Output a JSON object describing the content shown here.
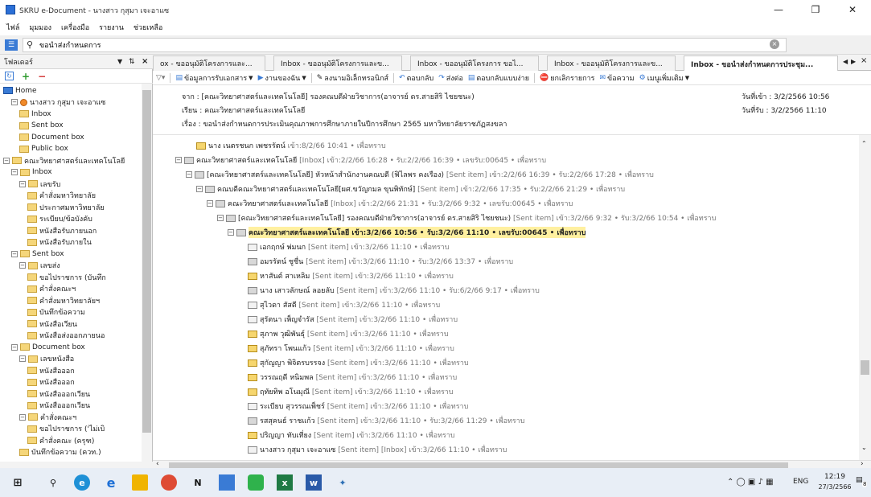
{
  "window": {
    "title": "SKRU e-Document - นางสาว กุสุมา เจะอาแซ"
  },
  "menu": [
    "ไฟล์",
    "มุมมอง",
    "เครื่องมือ",
    "รายงาน",
    "ช่วยเหลือ"
  ],
  "search": {
    "value": "ขอนำส่งกำหนดการ"
  },
  "sidebar": {
    "title": "โฟลเดอร์",
    "tree": [
      {
        "label": "Home",
        "indent": 0,
        "pm": ""
      },
      {
        "label": "นางสาว กุสุมา เจะอาแซ",
        "indent": 1,
        "pm": "−"
      },
      {
        "label": "Inbox",
        "indent": 2,
        "pm": ""
      },
      {
        "label": "Sent box",
        "indent": 2,
        "pm": ""
      },
      {
        "label": "Document box",
        "indent": 2,
        "pm": ""
      },
      {
        "label": "Public box",
        "indent": 2,
        "pm": ""
      },
      {
        "label": "คณะวิทยาศาสตร์และเทคโนโลยี",
        "indent": 0,
        "pm": "−"
      },
      {
        "label": "Inbox",
        "indent": 1,
        "pm": "−"
      },
      {
        "label": "เลขรับ",
        "indent": 2,
        "pm": "−"
      },
      {
        "label": "คำสั่งมหาวิทยาลัย",
        "indent": 3,
        "pm": ""
      },
      {
        "label": "ประกาศมหาวิทยาลัย",
        "indent": 3,
        "pm": ""
      },
      {
        "label": "ระเบียบ/ข้อบังคับ",
        "indent": 3,
        "pm": ""
      },
      {
        "label": "หนังสือรับภายนอก",
        "indent": 3,
        "pm": ""
      },
      {
        "label": "หนังสือรับภายใน",
        "indent": 3,
        "pm": ""
      },
      {
        "label": "Sent box",
        "indent": 1,
        "pm": "−"
      },
      {
        "label": "เลขส่ง",
        "indent": 2,
        "pm": "−"
      },
      {
        "label": "ขอไปราชการ (บันทึก",
        "indent": 3,
        "pm": ""
      },
      {
        "label": "คำสั่งคณะฯ",
        "indent": 3,
        "pm": ""
      },
      {
        "label": "คำสั่งมหาวิทยาลัยฯ",
        "indent": 3,
        "pm": ""
      },
      {
        "label": "บันทึกข้อความ",
        "indent": 3,
        "pm": ""
      },
      {
        "label": "หนังสือเวียน",
        "indent": 3,
        "pm": ""
      },
      {
        "label": "หนังสือส่งออกภายนอ",
        "indent": 3,
        "pm": ""
      },
      {
        "label": "Document box",
        "indent": 1,
        "pm": "−"
      },
      {
        "label": "เลขหนังสือ",
        "indent": 2,
        "pm": "−"
      },
      {
        "label": "หนังสือออก",
        "indent": 3,
        "pm": ""
      },
      {
        "label": "หนังสือออก",
        "indent": 3,
        "pm": ""
      },
      {
        "label": "หนังสือออกเวียน",
        "indent": 3,
        "pm": ""
      },
      {
        "label": "หนังสือออกเวียน",
        "indent": 3,
        "pm": ""
      },
      {
        "label": "คำสั่งคณะฯ",
        "indent": 2,
        "pm": "−"
      },
      {
        "label": "ขอไปราชการ ('ไม่เบิ",
        "indent": 3,
        "pm": ""
      },
      {
        "label": "คำสั่งคณะ (ครุฑ)",
        "indent": 3,
        "pm": ""
      },
      {
        "label": "บันทึกข้อความ (ควท.)",
        "indent": 2,
        "pm": ""
      }
    ]
  },
  "tabs": [
    {
      "label": "ox - ขออนุมัติโครงการและ...",
      "active": false
    },
    {
      "label": "Inbox - ขออนุมัติโครงการและข...",
      "active": false
    },
    {
      "label": "Inbox - ขออนุมัติโครงการ ขอไ...",
      "active": false
    },
    {
      "label": "Inbox - ขออนุมัติโครงการและข...",
      "active": false
    },
    {
      "label": "Inbox - ขอนำส่งกำหนดการประชุม...",
      "active": true
    }
  ],
  "toolbar": [
    "ข้อมูลการรับเอกสาร",
    "งานของฉัน",
    "ลงนามอิเล็กทรอนิกส์",
    "ตอบกลับ",
    "ส่งต่อ",
    "ตอบกลับแบบง่าย",
    "ยกเลิกรายการ",
    "ข้อความ",
    "เมนูเพิ่มเติม"
  ],
  "header": {
    "from": "จาก : [คณะวิทยาศาสตร์และเทคโนโลยี] รองคณบดีฝ่ายวิชาการ(อาจารย์ ดร.สายสิริ ไชยชนะ)",
    "to": "เรียน : คณะวิทยาศาสตร์และเทคโนโลยี",
    "subject": "เรื่อง : ขอนำส่งกำหนดการประเมินคุณภาพการศึกษาภายในปีการศึกษา 2565 มหาวิทยาลัยราชภัฏสงขลา",
    "date_in": "วันที่เข้า : 3/2/2566 10:56",
    "date_recv": "วันที่รับ : 3/2/2566 11:10"
  },
  "messages": [
    {
      "name": "นาง เนตรชนก เพชรรัตน์",
      "rest": " เข้า:8/2/66 10:41 • เพื่อทราบ",
      "indent": 0,
      "icon": "y",
      "pm": ""
    },
    {
      "name": "คณะวิทยาศาสตร์และเทคโนโลยี",
      "rest": " [Inbox] เข้า:2/2/66 16:28 • รับ:2/2/66 16:39 • เลขรับ:00645 • เพื่อทราบ",
      "indent": 0,
      "icon": "g",
      "pm": "−"
    },
    {
      "name": "[คณะวิทยาศาสตร์และเทคโนโลยี] หัวหน้าสำนักงานคณบดี (ฟิไลพร คงเรือง)",
      "rest": " [Sent item] เข้า:2/2/66 16:39 • รับ:2/2/66 17:28 • เพื่อทราบ",
      "indent": 1,
      "icon": "g",
      "pm": "−"
    },
    {
      "name": "คณบดีคณะวิทยาศาสตร์และเทคโนโลยี[ผศ.ขวัญกมล ขุนพิทักษ์]",
      "rest": " [Sent item] เข้า:2/2/66 17:35 • รับ:2/2/66 21:29 • เพื่อทราบ",
      "indent": 2,
      "icon": "g",
      "pm": "−"
    },
    {
      "name": "คณะวิทยาศาสตร์และเทคโนโลยี",
      "rest": " [Inbox] เข้า:2/2/66 21:31 • รับ:3/2/66 9:32 • เลขรับ:00645 • เพื่อทราบ",
      "indent": 3,
      "icon": "g",
      "pm": "−"
    },
    {
      "name": "[คณะวิทยาศาสตร์และเทคโนโลยี] รองคณบดีฝ่ายวิชาการ(อาจารย์ ดร.สายสิริ ไชยชนะ)",
      "rest": " [Sent item] เข้า:3/2/66 9:32 • รับ:3/2/66 10:54 • เพื่อทราบ",
      "indent": 4,
      "icon": "g",
      "pm": "−"
    },
    {
      "name": "คณะวิทยาศาสตร์และเทคโนโลยี",
      "rest": " เข้า:3/2/66 10:56 • รับ:3/2/66 11:10 • เลขรับ:00645 • เพื่อทราบ",
      "indent": 5,
      "icon": "g",
      "pm": "−",
      "highlight": true
    },
    {
      "name": "เอกฤกษ์ พ่มนก",
      "rest": " [Sent item] เข้า:3/2/66 11:10 • เพื่อทราบ",
      "indent": 6,
      "icon": "n",
      "pm": ""
    },
    {
      "name": "อมรรัตน์ ชูชื่น",
      "rest": " [Sent item] เข้า:3/2/66 11:10 • รับ:3/2/66 13:37 • เพื่อทราบ",
      "indent": 6,
      "icon": "g",
      "pm": ""
    },
    {
      "name": "หาสันต์ สาเหลิม",
      "rest": " [Sent item] เข้า:3/2/66 11:10 • เพื่อทราบ",
      "indent": 6,
      "icon": "y",
      "pm": ""
    },
    {
      "name": "นาง เสาวลักษณ์ ลอยลับ",
      "rest": " [Sent item] เข้า:3/2/66 11:10 • รับ:6/2/66 9:17 • เพื่อทราบ",
      "indent": 6,
      "icon": "g",
      "pm": ""
    },
    {
      "name": "สุไวดา สัสดี",
      "rest": " [Sent item] เข้า:3/2/66 11:10 • เพื่อทราบ",
      "indent": 6,
      "icon": "n",
      "pm": ""
    },
    {
      "name": "สุรัตนา เพ็ญจำรัส",
      "rest": " [Sent item] เข้า:3/2/66 11:10 • เพื่อทราบ",
      "indent": 6,
      "icon": "n",
      "pm": ""
    },
    {
      "name": "สุภาพ วุฒิพันธุ์",
      "rest": " [Sent item] เข้า:3/2/66 11:10 • เพื่อทราบ",
      "indent": 6,
      "icon": "y",
      "pm": ""
    },
    {
      "name": "สุภัทรา โพนแก้ว",
      "rest": " [Sent item] เข้า:3/2/66 11:10 • เพื่อทราบ",
      "indent": 6,
      "icon": "y",
      "pm": ""
    },
    {
      "name": "สุกัญญา พิจิตรบรรจง",
      "rest": " [Sent item] เข้า:3/2/66 11:10 • เพื่อทราบ",
      "indent": 6,
      "icon": "y",
      "pm": ""
    },
    {
      "name": "วรรณฤดี หนิมพล",
      "rest": " [Sent item] เข้า:3/2/66 11:10 • เพื่อทราบ",
      "indent": 6,
      "icon": "y",
      "pm": ""
    },
    {
      "name": "ฤทัยทิพ อโนมุณี",
      "rest": " [Sent item] เข้า:3/2/66 11:10 • เพื่อทราบ",
      "indent": 6,
      "icon": "y",
      "pm": ""
    },
    {
      "name": "ระเบียบ สุวรรณเพ็ชร์",
      "rest": " [Sent item] เข้า:3/2/66 11:10 • เพื่อทราบ",
      "indent": 6,
      "icon": "n",
      "pm": ""
    },
    {
      "name": "รสสุคนธ์ ราชแก้ว",
      "rest": " [Sent item] เข้า:3/2/66 11:10 • รับ:3/2/66 11:29 • เพื่อทราบ",
      "indent": 6,
      "icon": "g",
      "pm": ""
    },
    {
      "name": "ปริญญา ทับเที่ยง",
      "rest": " [Sent item] เข้า:3/2/66 11:10 • เพื่อทราบ",
      "indent": 6,
      "icon": "y",
      "pm": ""
    },
    {
      "name": "นางสาว กุสุมา เจะอาแซ",
      "rest": " [Sent item] [Inbox] เข้า:3/2/66 11:10 • เพื่อทราบ",
      "indent": 6,
      "icon": "n",
      "pm": ""
    }
  ],
  "taskbar": {
    "lang": "ENG",
    "time": "12:19",
    "date": "27/3/2566",
    "notif": "8"
  },
  "colors": {
    "accent": "#2b6fd6",
    "highlight": "#fff0a0",
    "folder": "#f5d67a"
  }
}
